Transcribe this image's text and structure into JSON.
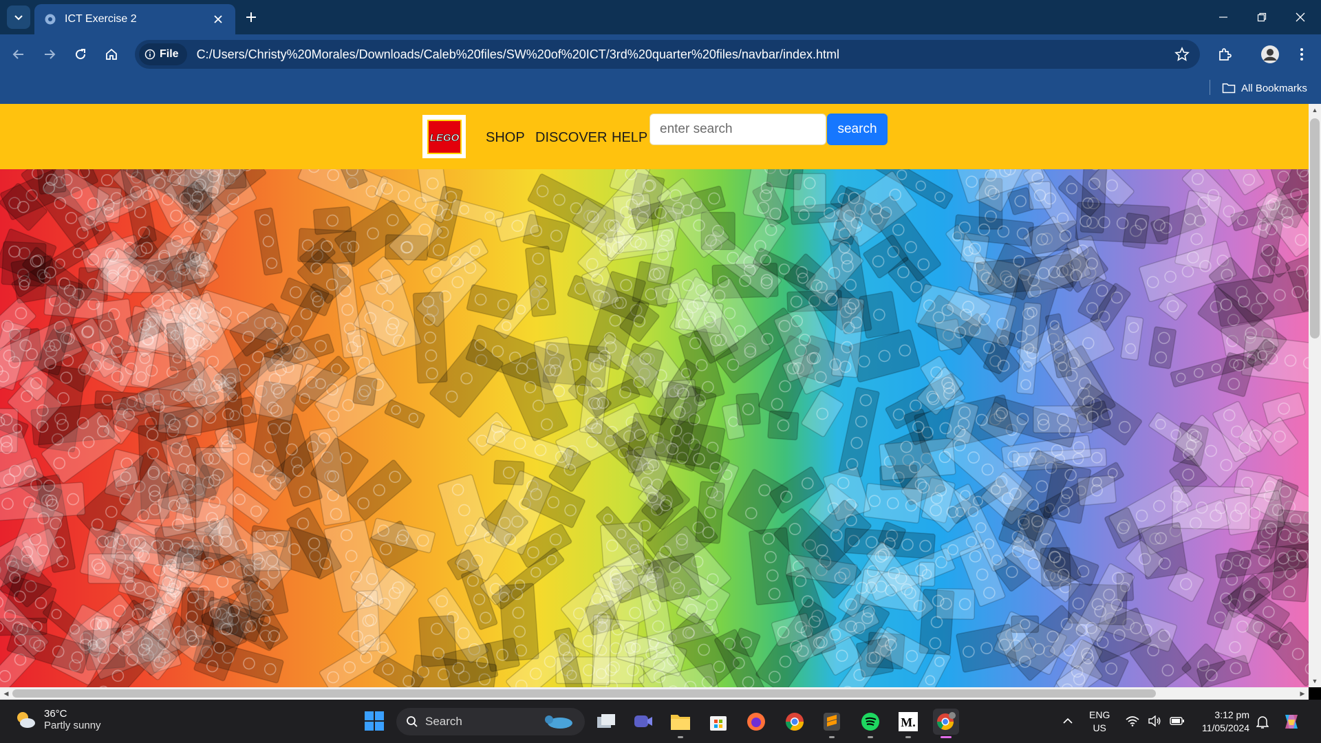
{
  "browser": {
    "tab_title": "ICT Exercise 2",
    "file_chip": "File",
    "url": "C:/Users/Christy%20Morales/Downloads/Caleb%20files/SW%20of%20ICT/3rd%20quarter%20files/navbar/index.html",
    "all_bookmarks": "All Bookmarks"
  },
  "site": {
    "logo_text": "LEGO",
    "nav": [
      "SHOP",
      "DISCOVER",
      "HELP"
    ],
    "search_placeholder": "enter search",
    "search_button": "search",
    "colors": {
      "nav_bg": "#ffc20e",
      "button": "#1677ff",
      "logo_red": "#e3000b"
    }
  },
  "taskbar": {
    "weather_temp": "36°C",
    "weather_desc": "Partly sunny",
    "search_label": "Search",
    "language": "ENG",
    "region": "US",
    "time": "3:12 pm",
    "date": "11/05/2024",
    "apps": [
      "task-view",
      "meet",
      "file-explorer",
      "microsoft-store",
      "firefox",
      "chrome",
      "sublime-text",
      "spotify",
      "medium",
      "chrome-profile"
    ]
  }
}
